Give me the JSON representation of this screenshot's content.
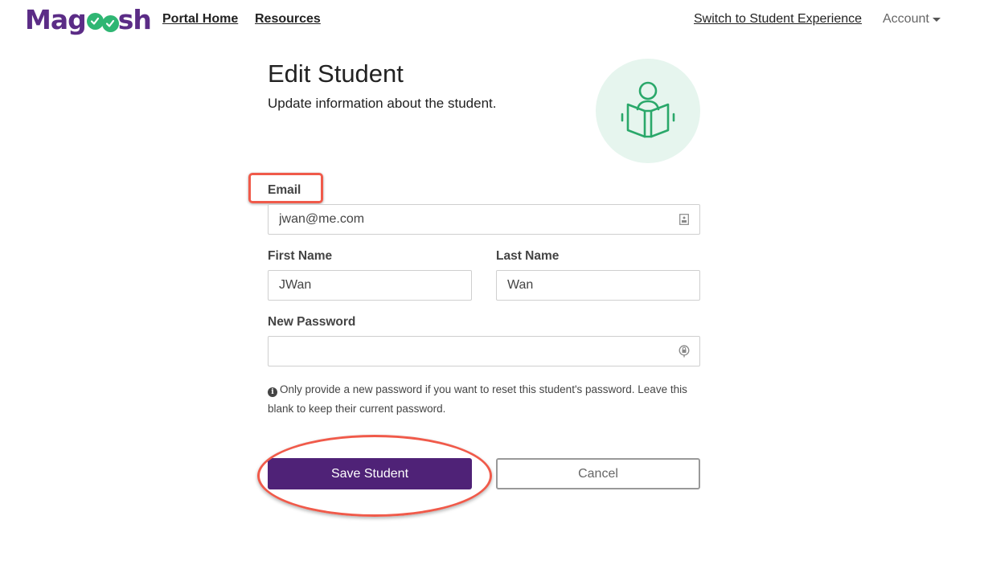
{
  "header": {
    "logo": {
      "prefix": "Mag",
      "suffix": "sh"
    },
    "nav": {
      "portal_home": "Portal Home",
      "resources": "Resources"
    },
    "switch_experience": "Switch to Student Experience",
    "account": "Account"
  },
  "page": {
    "title": "Edit Student",
    "subtitle": "Update information about the student.",
    "hero_icon": "student-reading-icon"
  },
  "form": {
    "email": {
      "label": "Email",
      "value": "jwan@me.com",
      "placeholder": ""
    },
    "first_name": {
      "label": "First Name",
      "value": "JWan"
    },
    "last_name": {
      "label": "Last Name",
      "value": "Wan"
    },
    "new_password": {
      "label": "New Password",
      "value": ""
    },
    "help_text": "Only provide a new password if you want to reset this student's password. Leave this blank to keep their current password."
  },
  "actions": {
    "save_label": "Save Student",
    "cancel_label": "Cancel"
  },
  "colors": {
    "brand_purple": "#4f2277",
    "brand_green": "#2fb673",
    "annotation_red": "#f05a4a"
  }
}
